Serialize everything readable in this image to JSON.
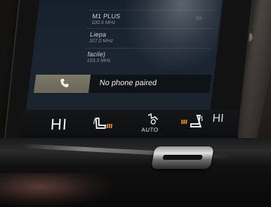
{
  "radio": {
    "stations": [
      {
        "name": "",
        "freq": ""
      },
      {
        "name": "M1 PLUS",
        "freq": "100.5 MHz"
      },
      {
        "name": "Liepa",
        "freq": "107.0 MHz"
      },
      {
        "name": "facile)",
        "freq": "103.3 MHz"
      }
    ]
  },
  "phone": {
    "status_text": "No phone paired",
    "icon": "phone-handset-icon"
  },
  "climate": {
    "left_temp": "HI",
    "right_temp": "HI",
    "fan_mode": "AUTO",
    "seat_heat_left_icon": "seat-heat-icon",
    "seat_heat_right_icon": "seat-heat-icon",
    "accent_color": "#e28a2a"
  }
}
